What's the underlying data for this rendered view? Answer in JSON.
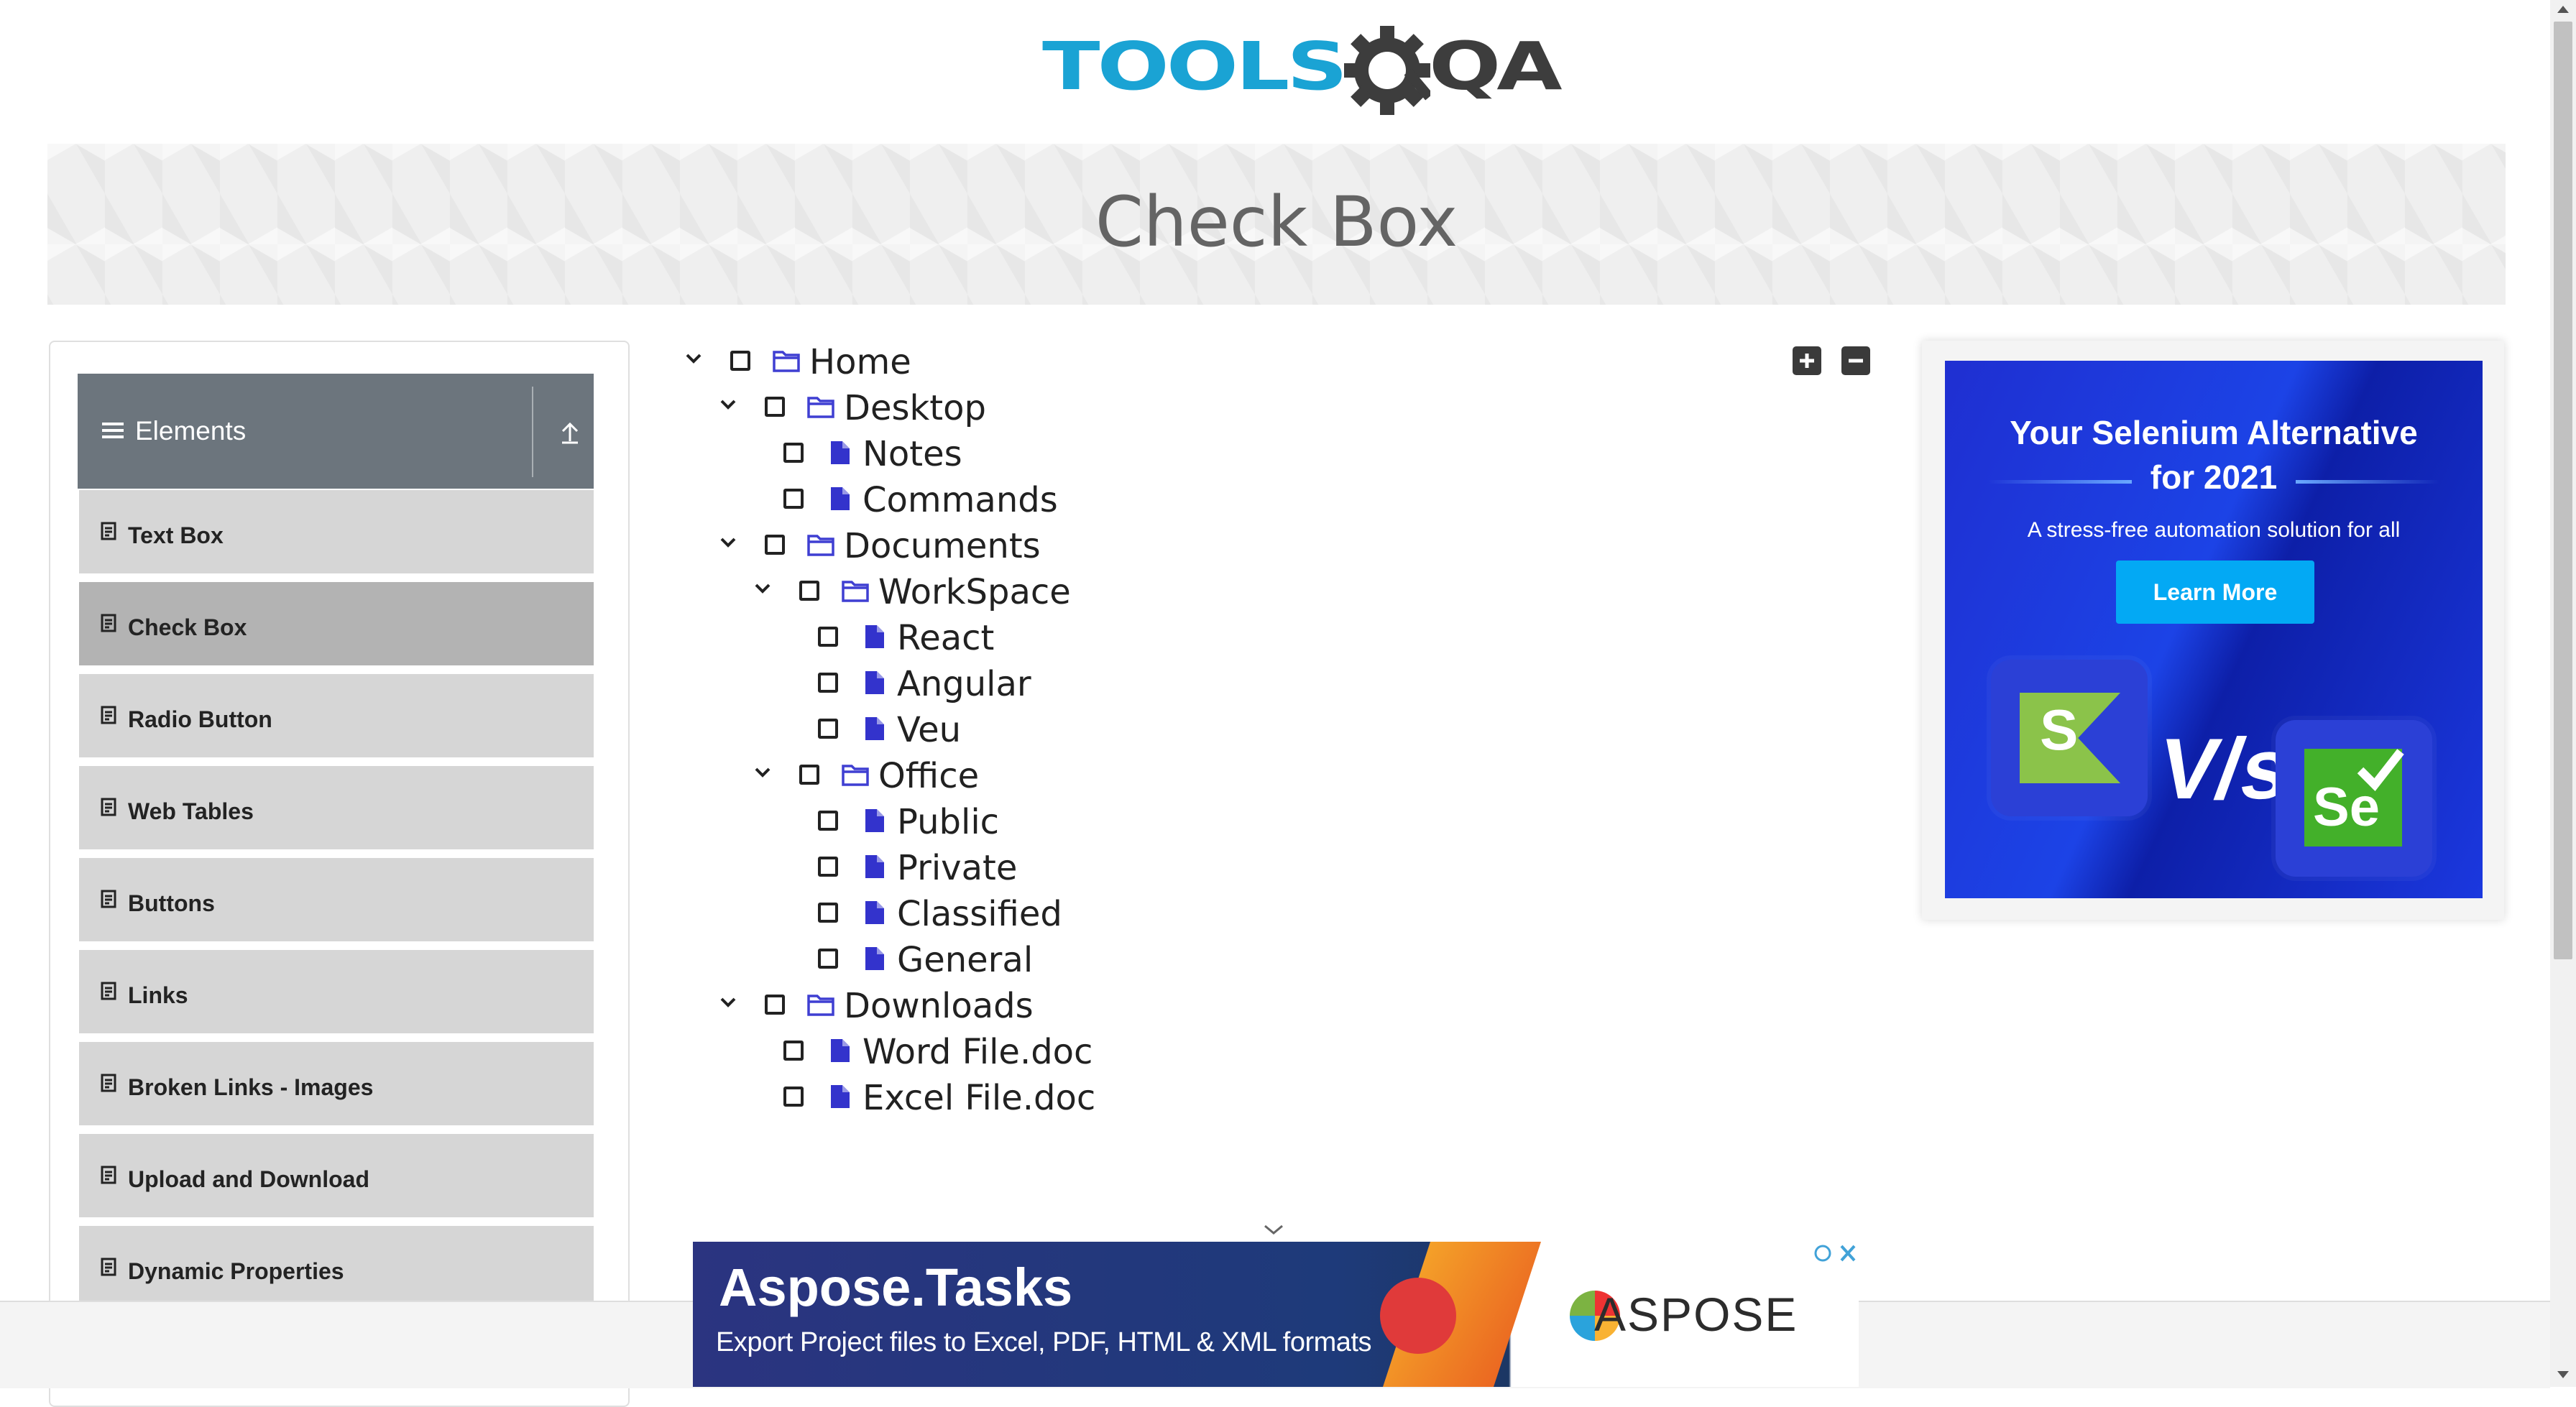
{
  "logo": {
    "part1": "TOOLS",
    "part2": "QA"
  },
  "banner": {
    "title": "Check Box"
  },
  "sidebar": {
    "group_title": "Elements",
    "items": [
      {
        "label": "Text Box"
      },
      {
        "label": "Check Box",
        "active": true
      },
      {
        "label": "Radio Button"
      },
      {
        "label": "Web Tables"
      },
      {
        "label": "Buttons"
      },
      {
        "label": "Links"
      },
      {
        "label": "Broken Links - Images"
      },
      {
        "label": "Upload and Download"
      },
      {
        "label": "Dynamic Properties"
      }
    ]
  },
  "tree": {
    "nodes": [
      {
        "label": "Home",
        "type": "folder",
        "expanded": true
      },
      {
        "label": "Desktop",
        "type": "folder",
        "expanded": true
      },
      {
        "label": "Notes",
        "type": "file"
      },
      {
        "label": "Commands",
        "type": "file"
      },
      {
        "label": "Documents",
        "type": "folder",
        "expanded": true
      },
      {
        "label": "WorkSpace",
        "type": "folder",
        "expanded": true
      },
      {
        "label": "React",
        "type": "file"
      },
      {
        "label": "Angular",
        "type": "file"
      },
      {
        "label": "Veu",
        "type": "file"
      },
      {
        "label": "Office",
        "type": "folder",
        "expanded": true
      },
      {
        "label": "Public",
        "type": "file"
      },
      {
        "label": "Private",
        "type": "file"
      },
      {
        "label": "Classified",
        "type": "file"
      },
      {
        "label": "General",
        "type": "file"
      },
      {
        "label": "Downloads",
        "type": "folder",
        "expanded": true
      },
      {
        "label": "Word File.doc",
        "type": "file"
      },
      {
        "label": "Excel File.doc",
        "type": "file"
      }
    ]
  },
  "side_ad": {
    "headline": "Your Selenium Alternative for 2021",
    "subline": "A stress-free automation solution for all",
    "cta": "Learn More",
    "vs": "V/s",
    "left_logo": "S",
    "right_logo": "Se"
  },
  "bottom_ad": {
    "title": "Aspose.Tasks",
    "subtitle": "Export Project files to Excel, PDF, HTML & XML formats",
    "brand": "ASPOSE"
  },
  "colors": {
    "folder_icon": "#3f3fd2",
    "file_icon": "#3333cc",
    "brand_blue": "#1aa3d4",
    "active_menu": "#b3b3b3"
  }
}
